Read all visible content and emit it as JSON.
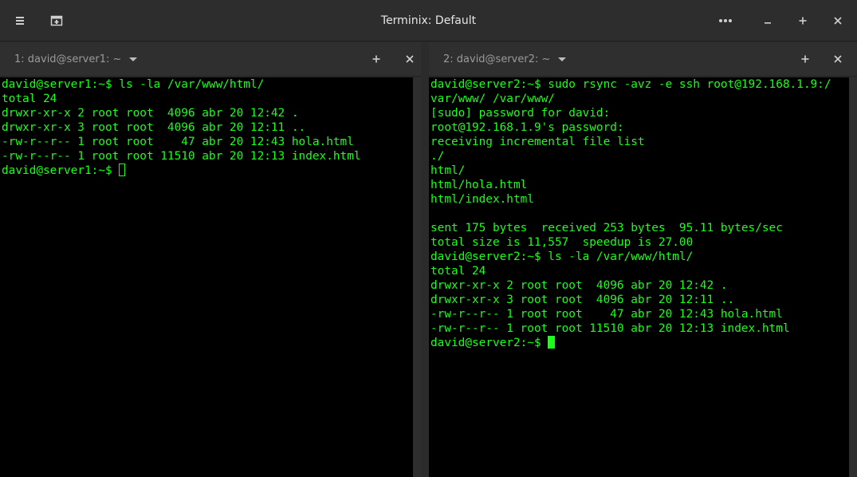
{
  "window": {
    "title": "Terminix: Default"
  },
  "panes": [
    {
      "title": "1: david@server1: ~",
      "lines": [
        "david@server1:~$ ls -la /var/www/html/",
        "total 24",
        "drwxr-xr-x 2 root root  4096 abr 20 12:42 .",
        "drwxr-xr-x 3 root root  4096 abr 20 12:11 ..",
        "-rw-r--r-- 1 root root    47 abr 20 12:43 hola.html",
        "-rw-r--r-- 1 root root 11510 abr 20 12:13 index.html"
      ],
      "prompt": "david@server1:~$ "
    },
    {
      "title": "2: david@server2: ~",
      "lines": [
        "david@server2:~$ sudo rsync -avz -e ssh root@192.168.1.9:/",
        "var/www/ /var/www/",
        "[sudo] password for david:",
        "root@192.168.1.9's password:",
        "receiving incremental file list",
        "./",
        "html/",
        "html/hola.html",
        "html/index.html",
        "",
        "sent 175 bytes  received 253 bytes  95.11 bytes/sec",
        "total size is 11,557  speedup is 27.00",
        "david@server2:~$ ls -la /var/www/html/",
        "total 24",
        "drwxr-xr-x 2 root root  4096 abr 20 12:42 .",
        "drwxr-xr-x 3 root root  4096 abr 20 12:11 ..",
        "-rw-r--r-- 1 root root    47 abr 20 12:43 hola.html",
        "-rw-r--r-- 1 root root 11510 abr 20 12:13 index.html"
      ],
      "prompt": "david@server2:~$ "
    }
  ],
  "colors": {
    "terminal_text": "#18ff18",
    "terminal_bg": "#000000",
    "chrome": "#2d2d2d"
  },
  "icons": {
    "menu": "hamburger-icon",
    "new_session": "add-session-icon",
    "more": "more-icon",
    "minimize": "minimize-icon",
    "maximize": "maximize-icon",
    "close": "close-icon",
    "add_terminal": "plus-icon",
    "close_terminal": "close-icon",
    "dropdown": "chevron-down-icon"
  }
}
